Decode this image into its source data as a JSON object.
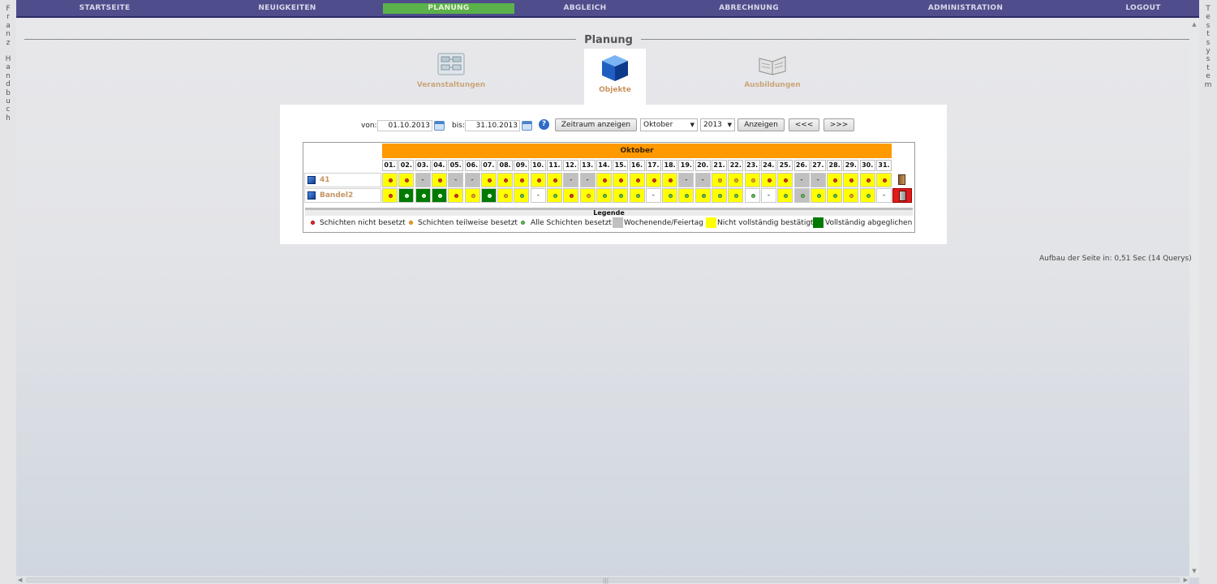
{
  "left_strip": {
    "letters1": [
      "F",
      "r",
      "a",
      "n",
      "z"
    ],
    "letters2": [
      "H",
      "a",
      "n",
      "d",
      "b",
      "u",
      "c",
      "h"
    ]
  },
  "right_strip": {
    "letters": [
      "T",
      "e",
      "s",
      "t",
      "s",
      "y",
      "s",
      "t",
      "e",
      "m"
    ]
  },
  "nav": {
    "items": [
      {
        "label": "STARTSEITE"
      },
      {
        "label": "NEUIGKEITEN"
      },
      {
        "label": "PLANUNG",
        "active": true
      },
      {
        "label": "ABGLEICH"
      },
      {
        "label": "ABRECHNUNG"
      },
      {
        "label": "ADMINISTRATION"
      },
      {
        "label": "LOGOUT"
      }
    ]
  },
  "page": {
    "title": "Planung"
  },
  "tabs": [
    {
      "label": "Veranstaltungen",
      "icon": "planning-board-icon"
    },
    {
      "label": "Objekte",
      "icon": "cube-icon",
      "active": true
    },
    {
      "label": "Ausbildungen",
      "icon": "book-icon"
    }
  ],
  "filter": {
    "von_label": "von:",
    "von_value": "01.10.2013",
    "bis_label": "bis:",
    "bis_value": "31.10.2013",
    "zeitraum_button": "Zeitraum anzeigen",
    "month_select": "Oktober",
    "year_select": "2013",
    "anzeigen_button": "Anzeigen",
    "prev_button": "<<<",
    "next_button": ">>>"
  },
  "grid": {
    "month": "Oktober",
    "days": [
      "01.",
      "02.",
      "03.",
      "04.",
      "05.",
      "06.",
      "07.",
      "08.",
      "09.",
      "10.",
      "11.",
      "12.",
      "13.",
      "14.",
      "15.",
      "16.",
      "17.",
      "18.",
      "19.",
      "20.",
      "21.",
      "22.",
      "23.",
      "24.",
      "25.",
      "26.",
      "27.",
      "28.",
      "29.",
      "30.",
      "31."
    ],
    "objects": [
      {
        "name": "41",
        "cells": [
          "Y:r",
          "Y:r",
          "G:-",
          "Y:r",
          "G:-",
          "G:-",
          "Y:r",
          "Y:r",
          "Y:r",
          "Y:r",
          "Y:r",
          "G:-",
          "G:-",
          "Y:r",
          "Y:r",
          "Y:r",
          "Y:r",
          "Y:r",
          "G:-",
          "G:-",
          "Y:o",
          "Y:o",
          "Y:o",
          "Y:r",
          "Y:r",
          "G:-",
          "G:-",
          "Y:r",
          "Y:r",
          "Y:r",
          "Y:r"
        ],
        "status": "door-open-icon"
      },
      {
        "name": "Bandel2",
        "cells": [
          "Y:r",
          "D:g",
          "D:g",
          "D:g",
          "Y:r",
          "Y:o",
          "D:g",
          "Y:o",
          "Y:g",
          "W:-",
          "Y:g",
          "Y:r",
          "Y:o",
          "Y:g",
          "Y:g",
          "Y:g",
          "W:-",
          "Y:g",
          "Y:g",
          "Y:g",
          "Y:g",
          "Y:g",
          "W:g",
          "W:-",
          "Y:g",
          "G:g",
          "Y:g",
          "Y:g",
          "Y:o",
          "Y:g",
          "W:-"
        ],
        "status": "door-closed-red-icon"
      }
    ],
    "legend_title": "Legende",
    "legend": {
      "not_staffed": "Schichten nicht besetzt",
      "partly_staffed": "Schichten teilweise besetzt",
      "all_staffed": "Alle Schichten besetzt",
      "weekend": "Wochenende/Feiertag",
      "not_confirmed": "Nicht vollständig bestätigt",
      "fully_reconciled": "Vollständig abgeglichen"
    }
  },
  "colors": {
    "nav_bg": "#4f4d8b",
    "nav_active": "#5bb14a",
    "month_bar": "#ff9900",
    "yellow": "#ffff00",
    "grey": "#c0c0c0",
    "dark_green": "#007a00",
    "dot_red": "#e03030",
    "dot_orange": "#f0a040",
    "dot_green": "#5fbf5f"
  },
  "footer": {
    "load_text": "Aufbau der Seite in: 0,51 Sec (14 Querys)"
  }
}
